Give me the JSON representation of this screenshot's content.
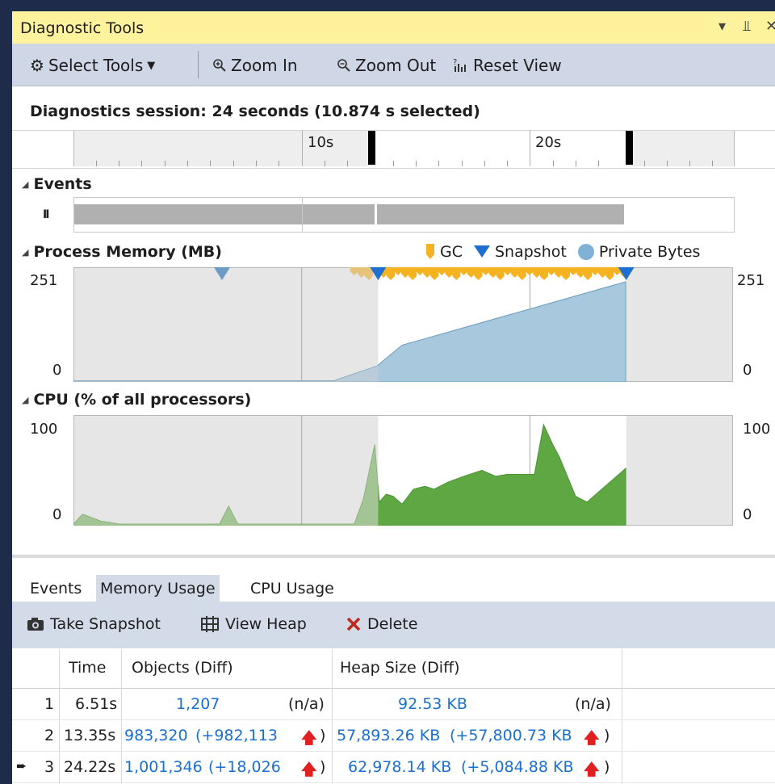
{
  "window": {
    "title": "Diagnostic Tools",
    "controls": [
      "▾",
      "⫫",
      "✕"
    ]
  },
  "toolbar": {
    "select_tools": "Select Tools",
    "zoom_in": "Zoom In",
    "zoom_out": "Zoom Out",
    "reset_view": "Reset View"
  },
  "session": {
    "text": "Diagnostics session: 24 seconds (10.874 s selected)"
  },
  "ruler": {
    "labels": [
      "10s",
      "20s"
    ]
  },
  "events": {
    "label": "Events",
    "pause": "II"
  },
  "memory": {
    "label": "Process Memory (MB)",
    "legend": {
      "gc": "GC",
      "snapshot": "Snapshot",
      "private_bytes": "Private Bytes"
    },
    "y_max": "251",
    "y_min": "0",
    "colors": {
      "gc": "#f5b321",
      "snapshot": "#1e6fd0",
      "private_bytes": "#a8c8dd"
    }
  },
  "cpu": {
    "label": "CPU (% of all processors)",
    "y_max": "100",
    "y_min": "0",
    "colors": {
      "fill": "#5ea743"
    }
  },
  "chart_data": [
    {
      "type": "area",
      "title": "Process Memory (MB)",
      "ylim": [
        0,
        251
      ],
      "x": [
        0,
        4.7,
        6.5,
        9.5,
        11.4,
        13.3,
        14.4,
        24.2
      ],
      "series": [
        {
          "name": "Private Bytes",
          "values": [
            3,
            3,
            3,
            3,
            3,
            40,
            92,
            251
          ]
        }
      ],
      "markers": {
        "Snapshot": [
          6.51,
          13.35,
          24.22
        ]
      },
      "gc_range": [
        12.3,
        24.2
      ],
      "selection": [
        13.35,
        24.22
      ]
    },
    {
      "type": "area",
      "title": "CPU (% of all processors)",
      "ylim": [
        0,
        100
      ],
      "x": [
        0,
        0.4,
        1.2,
        2.0,
        6.0,
        6.4,
        6.8,
        7.2,
        11.8,
        12.3,
        12.7,
        13.2,
        13.4,
        13.7,
        14.0,
        14.4,
        14.9,
        15.4,
        15.8,
        16.4,
        17.1,
        17.9,
        18.5,
        19.0,
        19.6,
        20.2,
        20.6,
        21.0,
        21.3,
        22.0,
        22.5,
        23.1,
        24.2
      ],
      "series": [
        {
          "name": "CPU",
          "values": [
            0,
            10,
            3,
            0,
            0,
            0,
            18,
            0,
            0,
            0,
            25,
            80,
            22,
            30,
            28,
            20,
            35,
            38,
            35,
            42,
            48,
            54,
            48,
            50,
            50,
            50,
            100,
            80,
            67,
            28,
            22,
            34,
            56
          ]
        }
      ]
    }
  ],
  "bottom_tabs": [
    "Events",
    "Memory Usage",
    "CPU Usage"
  ],
  "bottom_tools": {
    "take_snapshot": "Take Snapshot",
    "view_heap": "View Heap",
    "delete": "Delete"
  },
  "table": {
    "headers": [
      "Time",
      "Objects (Diff)",
      "Heap Size (Diff)"
    ],
    "rows": [
      {
        "num": "1",
        "time": "6.51s",
        "objects": "1,207",
        "objects_diff": "(n/a)",
        "heap": "92.53 KB",
        "heap_diff": "(n/a)",
        "current": false
      },
      {
        "num": "2",
        "time": "13.35s",
        "objects": "983,320",
        "objects_diff": "(+982,113",
        "heap": "57,893.26 KB",
        "heap_diff": "(+57,800.73 KB",
        "current": false
      },
      {
        "num": "3",
        "time": "24.22s",
        "objects": "1,001,346",
        "objects_diff": "(+18,026",
        "heap": "62,978.14 KB",
        "heap_diff": "(+5,084.88 KB",
        "current": true
      }
    ]
  }
}
